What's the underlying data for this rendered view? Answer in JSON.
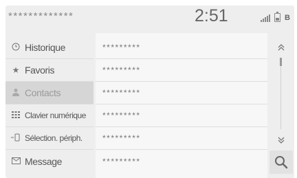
{
  "status": {
    "device_name": "*************",
    "clock": "2:51",
    "bt_label": "B"
  },
  "sidebar": {
    "items": [
      {
        "label": "Historique",
        "icon": "clock-icon",
        "active": false
      },
      {
        "label": "Favoris",
        "icon": "star-icon",
        "active": false
      },
      {
        "label": "Contacts",
        "icon": "contacts-icon",
        "active": true
      },
      {
        "label": "Clavier numérique",
        "icon": "keypad-icon",
        "active": false
      },
      {
        "label": "Sélection. périph.",
        "icon": "device-select-icon",
        "active": false
      },
      {
        "label": "Message",
        "icon": "message-icon",
        "active": false
      }
    ]
  },
  "list": {
    "rows": [
      "*********",
      "*********",
      "*********",
      "*********",
      "*********",
      "*********"
    ]
  },
  "controls": {
    "scroll_up_icon": "double-chevron-up-icon",
    "scroll_down_icon": "double-chevron-down-icon",
    "search_icon": "search-icon"
  },
  "colors": {
    "background": "#eeeeee",
    "active_item": "#d6d6d6",
    "list_background": "#f7f7f7"
  }
}
